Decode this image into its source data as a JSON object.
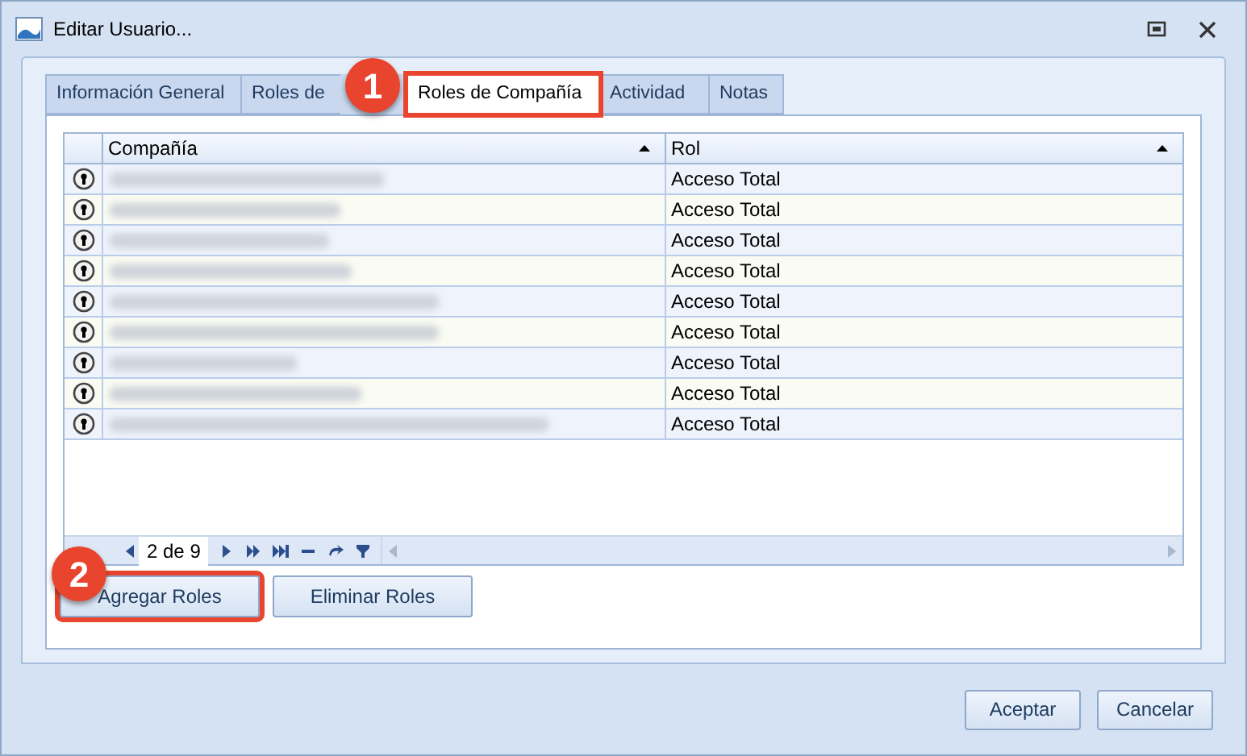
{
  "window": {
    "title": "Editar Usuario..."
  },
  "tabs": [
    {
      "label": "Información General",
      "selected": false,
      "highlighted": false
    },
    {
      "label": "Roles de",
      "selected": false,
      "highlighted": false
    },
    {
      "label": "Roles de Compañía",
      "selected": true,
      "highlighted": true
    },
    {
      "label": "Actividad",
      "selected": false,
      "highlighted": false
    },
    {
      "label": "Notas",
      "selected": false,
      "highlighted": false
    }
  ],
  "grid": {
    "columns": [
      {
        "label": "Compañía"
      },
      {
        "label": "Rol"
      }
    ],
    "rows": [
      {
        "rol": "Acceso Total"
      },
      {
        "rol": "Acceso Total"
      },
      {
        "rol": "Acceso Total"
      },
      {
        "rol": "Acceso Total"
      },
      {
        "rol": "Acceso Total"
      },
      {
        "rol": "Acceso Total"
      },
      {
        "rol": "Acceso Total"
      },
      {
        "rol": "Acceso Total"
      },
      {
        "rol": "Acceso Total"
      }
    ]
  },
  "pager": {
    "page": "2 de 9"
  },
  "actions": [
    {
      "label": "Agregar Roles",
      "highlighted": true
    },
    {
      "label": "Eliminar Roles",
      "highlighted": false
    }
  ],
  "footer_buttons": [
    "Aceptar",
    "Cancelar"
  ],
  "callouts": [
    {
      "text": "1"
    },
    {
      "text": "2"
    }
  ]
}
